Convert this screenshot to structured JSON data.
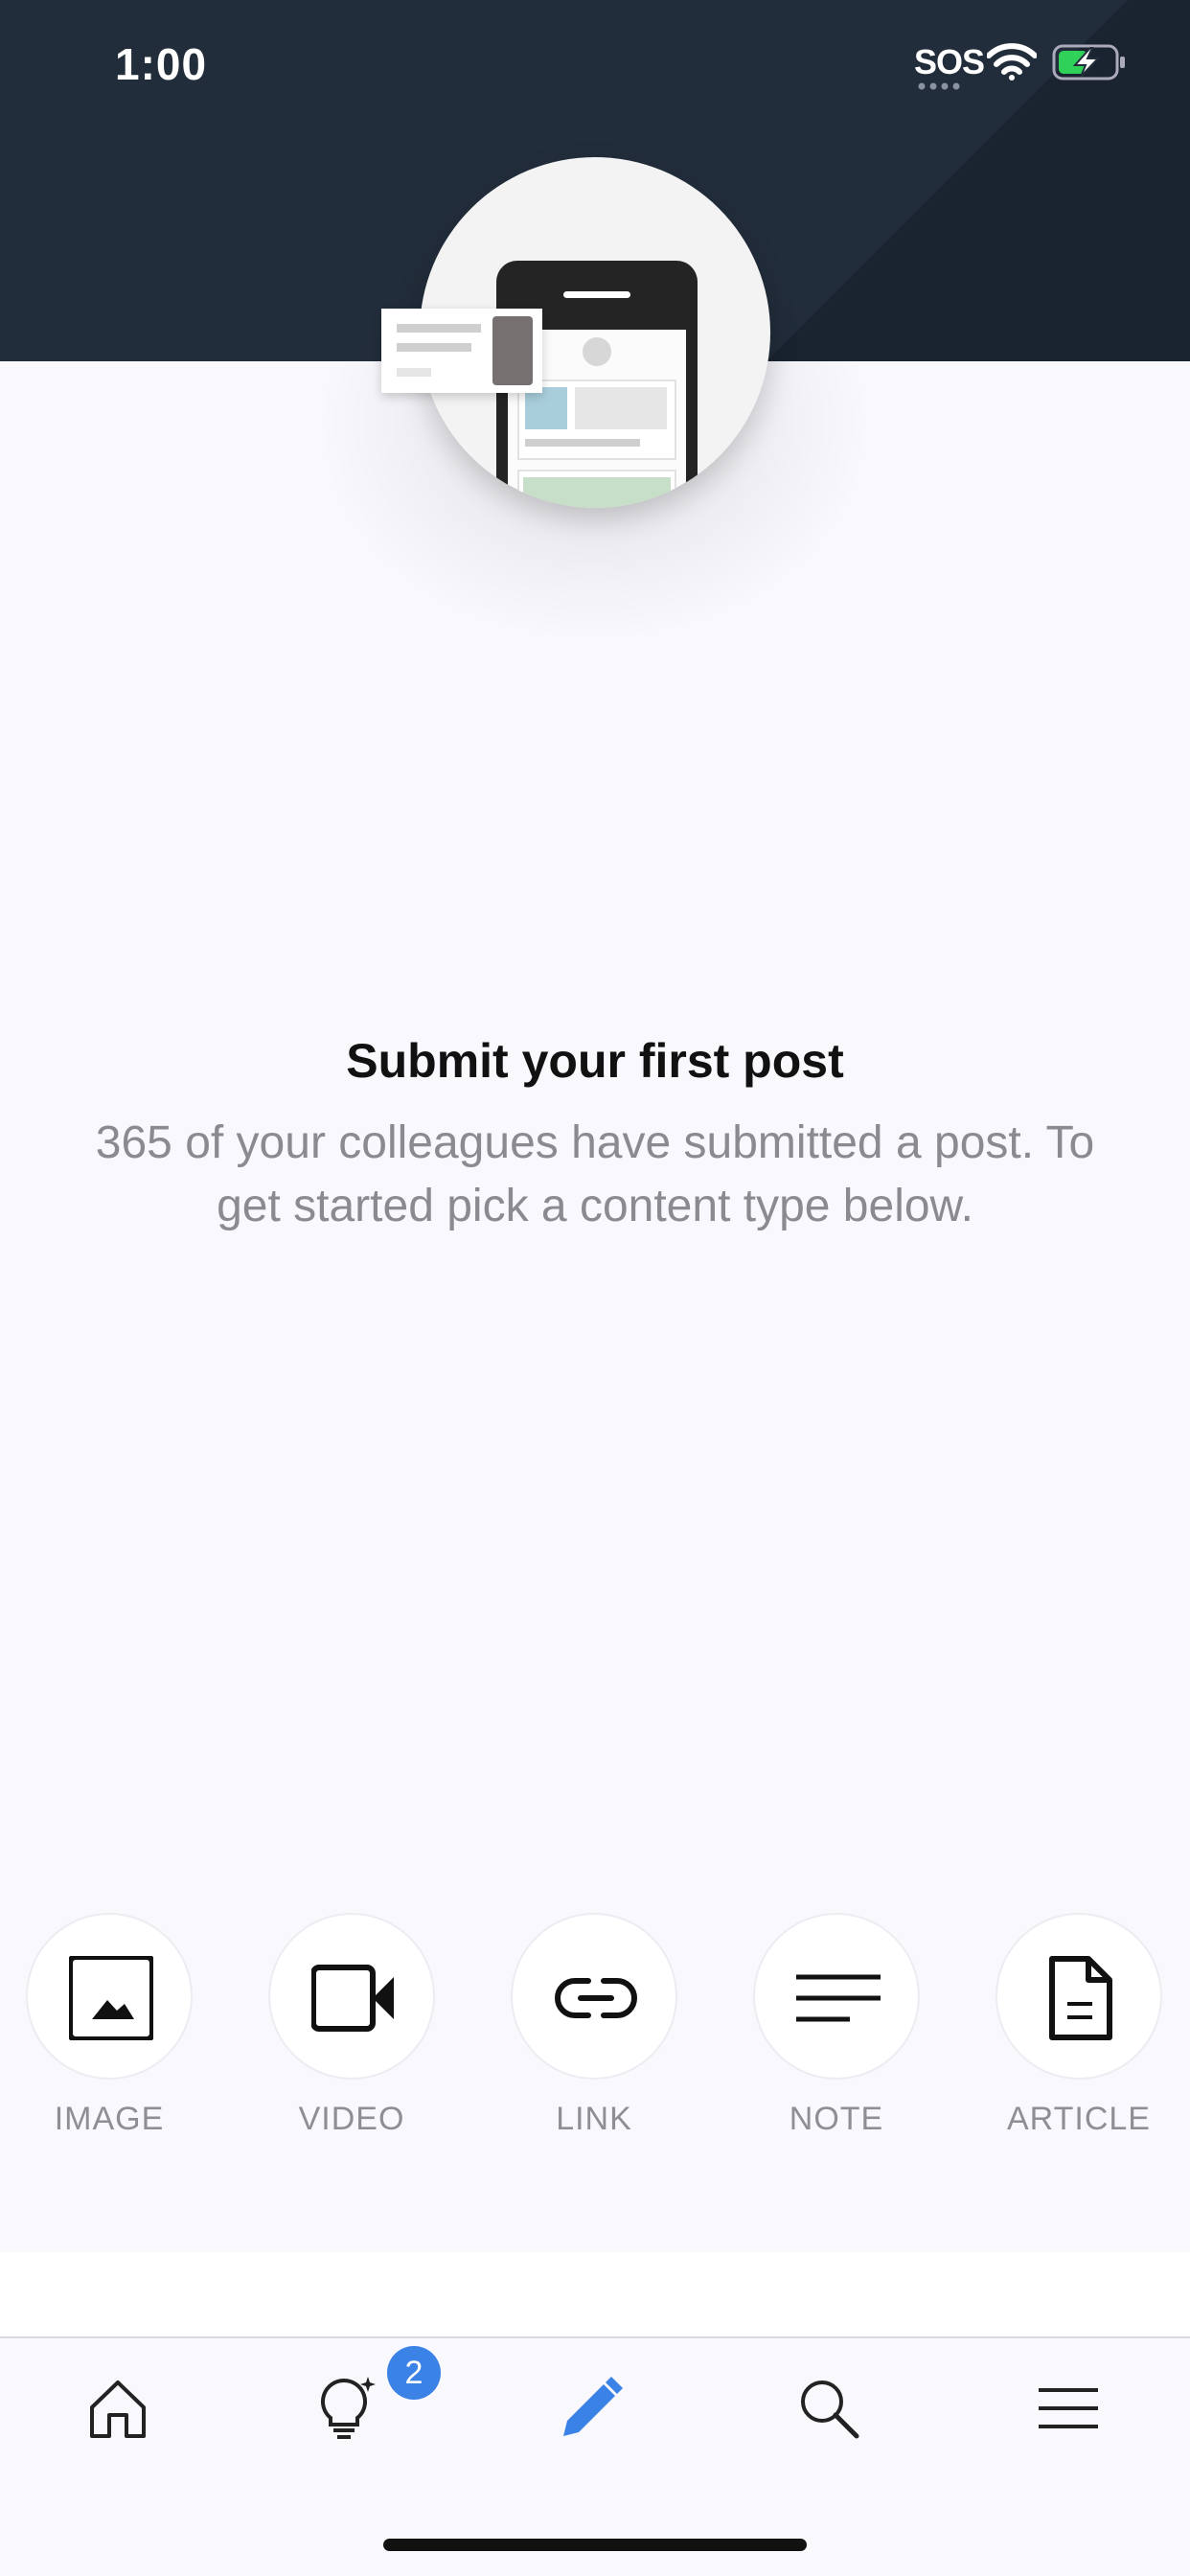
{
  "status_bar": {
    "time": "1:00",
    "sos": "SOS",
    "icons": [
      "sos-indicator",
      "wifi-icon",
      "battery-charging-icon"
    ]
  },
  "empty_state": {
    "title": "Submit your first post",
    "subtitle": "365 of your colleagues have submitted a post. To get started pick a content type below."
  },
  "content_types": [
    {
      "label": "IMAGE",
      "icon": "image-icon"
    },
    {
      "label": "VIDEO",
      "icon": "video-camera-icon"
    },
    {
      "label": "LINK",
      "icon": "link-icon"
    },
    {
      "label": "NOTE",
      "icon": "note-lines-icon"
    },
    {
      "label": "ARTICLE",
      "icon": "document-icon"
    }
  ],
  "tab_bar": {
    "tabs": [
      {
        "name": "home",
        "icon": "home-icon"
      },
      {
        "name": "ideas",
        "icon": "lightbulb-icon",
        "badge": "2"
      },
      {
        "name": "compose",
        "icon": "pencil-icon",
        "active": true
      },
      {
        "name": "search",
        "icon": "search-icon"
      },
      {
        "name": "menu",
        "icon": "hamburger-menu-icon"
      }
    ]
  },
  "colors": {
    "header_bg": "#222d3b",
    "accent": "#3b82e6",
    "background": "#f8f8fd"
  }
}
